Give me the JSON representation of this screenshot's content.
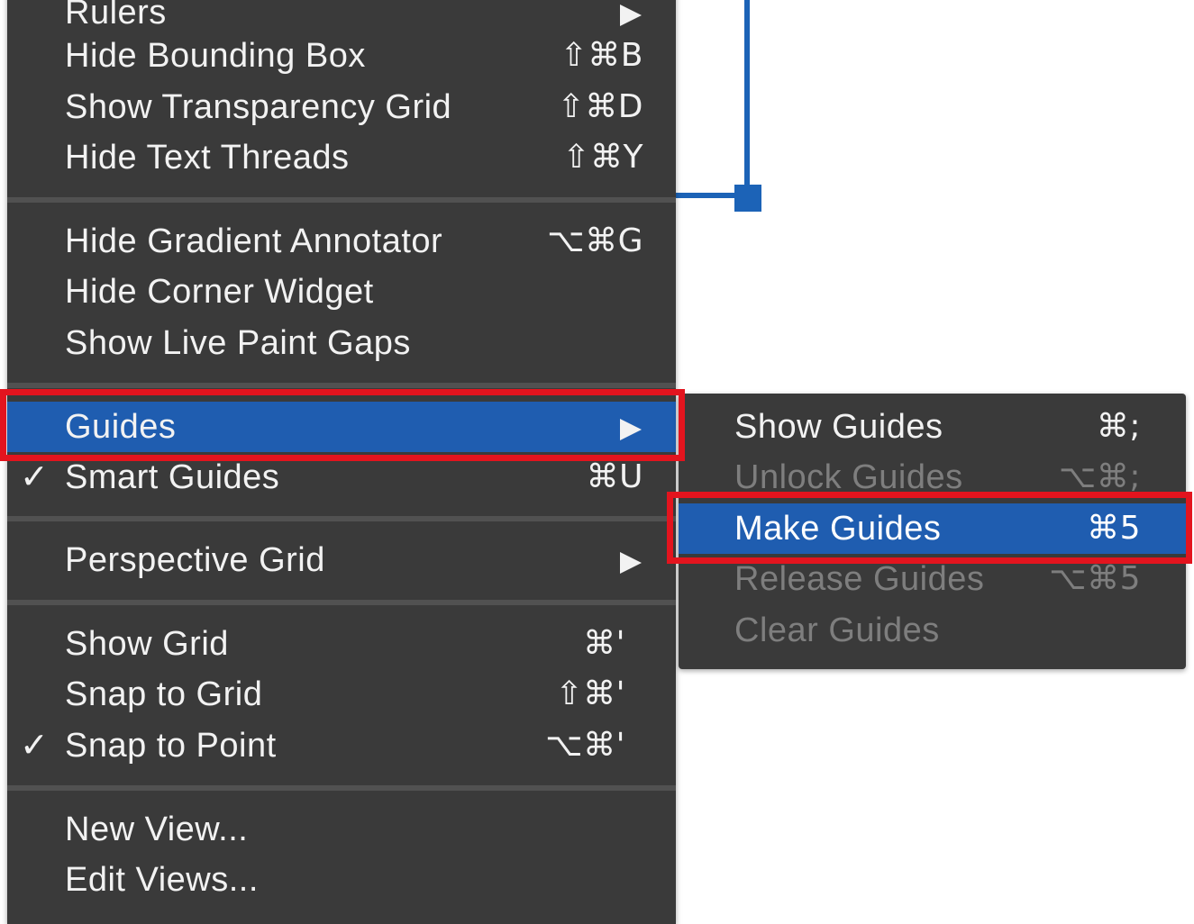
{
  "main_menu": {
    "items": [
      {
        "label": "Rulers",
        "shortcut": "",
        "checked": false,
        "submenu": true
      },
      {
        "label": "Hide Bounding Box",
        "shortcut": "⇧⌘B",
        "checked": false,
        "submenu": false
      },
      {
        "label": "Show Transparency Grid",
        "shortcut": "⇧⌘D",
        "checked": false,
        "submenu": false
      },
      {
        "label": "Hide Text Threads",
        "shortcut": "⇧⌘Y",
        "checked": false,
        "submenu": false
      },
      {
        "label": "Hide Gradient Annotator",
        "shortcut": "⌥⌘G",
        "checked": false,
        "submenu": false
      },
      {
        "label": "Hide Corner Widget",
        "shortcut": "",
        "checked": false,
        "submenu": false
      },
      {
        "label": "Show Live Paint Gaps",
        "shortcut": "",
        "checked": false,
        "submenu": false
      },
      {
        "label": "Guides",
        "shortcut": "",
        "checked": false,
        "submenu": true,
        "highlighted": true
      },
      {
        "label": "Smart Guides",
        "shortcut": "⌘U",
        "checked": true,
        "submenu": false
      },
      {
        "label": "Perspective Grid",
        "shortcut": "",
        "checked": false,
        "submenu": true
      },
      {
        "label": "Show Grid",
        "shortcut": "⌘'",
        "checked": false,
        "submenu": false
      },
      {
        "label": "Snap to Grid",
        "shortcut": "⇧⌘'",
        "checked": false,
        "submenu": false
      },
      {
        "label": "Snap to Point",
        "shortcut": "⌥⌘'",
        "checked": true,
        "submenu": false
      },
      {
        "label": "New View...",
        "shortcut": "",
        "checked": false,
        "submenu": false
      },
      {
        "label": "Edit Views...",
        "shortcut": "",
        "checked": false,
        "submenu": false
      }
    ],
    "check_glyph": "✓"
  },
  "guides_submenu": {
    "items": [
      {
        "label": "Show Guides",
        "shortcut": "⌘;",
        "enabled": true
      },
      {
        "label": "Unlock Guides",
        "shortcut": "⌥⌘;",
        "enabled": false
      },
      {
        "label": "Make Guides",
        "shortcut": "⌘5",
        "enabled": true,
        "highlighted": true
      },
      {
        "label": "Release Guides",
        "shortcut": "⌥⌘5",
        "enabled": false
      },
      {
        "label": "Clear Guides",
        "shortcut": "",
        "enabled": false
      }
    ]
  },
  "colors": {
    "menu_background": "#3a3a3a",
    "highlight": "#1f5db0",
    "annotation": "#e3141e",
    "artboard_bracket": "#1c63b7"
  }
}
